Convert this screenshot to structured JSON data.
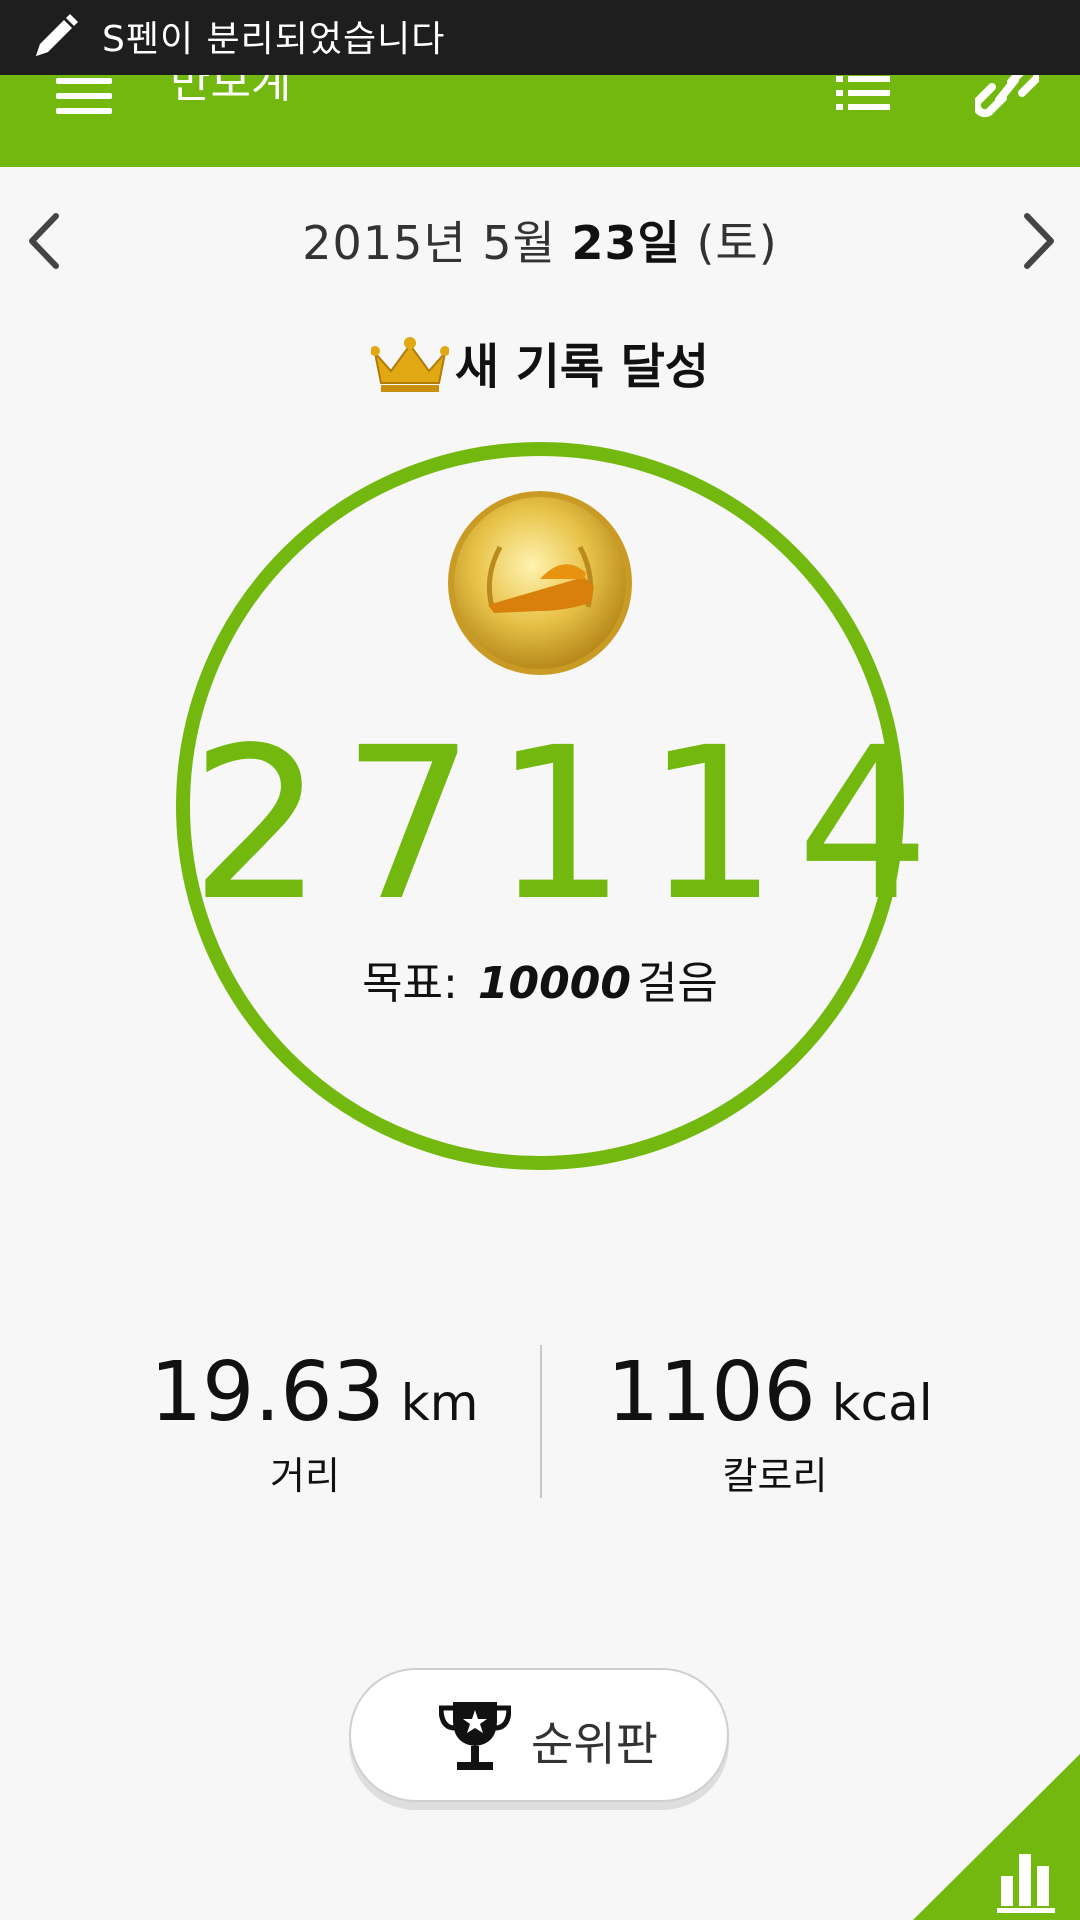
{
  "notification": {
    "text": "S펜이 분리되었습니다",
    "icon": "pen-icon"
  },
  "appbar": {
    "title": "만보계",
    "menu_icon": "hamburger-menu-icon",
    "list_icon": "list-icon",
    "link_icon": "link-icon",
    "color": "#72b80e"
  },
  "date": {
    "prefix": "2015년 5월",
    "day": "23일",
    "weekday": "(토)"
  },
  "record": {
    "text": "새 기록 달성",
    "icon": "crown-icon"
  },
  "steps": {
    "count": "27114",
    "goal_label": "목표:",
    "goal_value": "10000",
    "goal_unit": "걸음",
    "medal_icon": "gold-shoe-medal-icon"
  },
  "stats": {
    "distance": {
      "value": "19.63",
      "unit": "km",
      "label": "거리"
    },
    "calories": {
      "value": "1106",
      "unit": "kcal",
      "label": "칼로리"
    }
  },
  "leaderboard": {
    "label": "순위판",
    "icon": "trophy-icon"
  },
  "corner": {
    "icon": "bar-chart-icon"
  }
}
